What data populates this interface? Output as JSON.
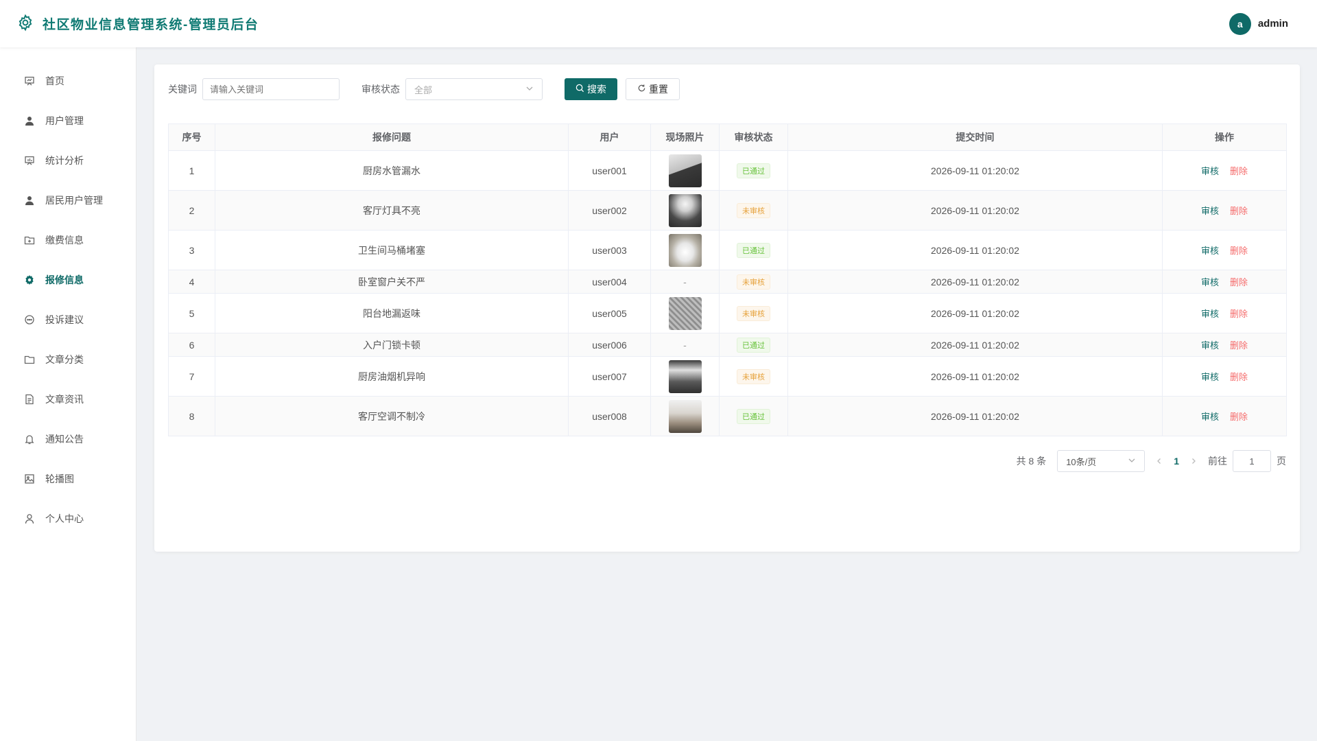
{
  "header": {
    "title": "社区物业信息管理系统-管理员后台",
    "avatar_letter": "a",
    "username": "admin"
  },
  "sidebar": {
    "items": [
      {
        "label": "首页",
        "icon": "dashboard-icon",
        "active": false
      },
      {
        "label": "用户管理",
        "icon": "user-icon",
        "active": false
      },
      {
        "label": "统计分析",
        "icon": "chart-icon",
        "active": false
      },
      {
        "label": "居民用户管理",
        "icon": "user-icon",
        "active": false
      },
      {
        "label": "缴费信息",
        "icon": "folder-add-icon",
        "active": false
      },
      {
        "label": "报修信息",
        "icon": "gear-icon",
        "active": true
      },
      {
        "label": "投诉建议",
        "icon": "chat-icon",
        "active": false
      },
      {
        "label": "文章分类",
        "icon": "folder-icon",
        "active": false
      },
      {
        "label": "文章资讯",
        "icon": "document-icon",
        "active": false
      },
      {
        "label": "通知公告",
        "icon": "bell-icon",
        "active": false
      },
      {
        "label": "轮播图",
        "icon": "picture-icon",
        "active": false
      },
      {
        "label": "个人中心",
        "icon": "person-icon",
        "active": false
      }
    ]
  },
  "filters": {
    "keyword_label": "关键词",
    "keyword_placeholder": "请输入关键词",
    "status_label": "审核状态",
    "status_value": "全部",
    "search_label": "搜索",
    "reset_label": "重置"
  },
  "table": {
    "columns": [
      "序号",
      "报修问题",
      "用户",
      "现场照片",
      "审核状态",
      "提交时间",
      "操作"
    ],
    "rows": [
      {
        "no": "1",
        "issue": "厨房水管漏水",
        "user": "user001",
        "photo": "kitchen-pipe",
        "status": "已通过",
        "time": "2026-09-11 01:20:02"
      },
      {
        "no": "2",
        "issue": "客厅灯具不亮",
        "user": "user002",
        "photo": "living-room-light",
        "status": "未审核",
        "time": "2026-09-11 01:20:02"
      },
      {
        "no": "3",
        "issue": "卫生间马桶堵塞",
        "user": "user003",
        "photo": "toilet",
        "status": "已通过",
        "time": "2026-09-11 01:20:02"
      },
      {
        "no": "4",
        "issue": "卧室窗户关不严",
        "user": "user004",
        "photo": "",
        "status": "未审核",
        "time": "2026-09-11 01:20:02"
      },
      {
        "no": "5",
        "issue": "阳台地漏返味",
        "user": "user005",
        "photo": "floor-drain",
        "status": "未审核",
        "time": "2026-09-11 01:20:02"
      },
      {
        "no": "6",
        "issue": "入户门锁卡顿",
        "user": "user006",
        "photo": "",
        "status": "已通过",
        "time": "2026-09-11 01:20:02"
      },
      {
        "no": "7",
        "issue": "厨房油烟机异响",
        "user": "user007",
        "photo": "range-hood",
        "status": "未审核",
        "time": "2026-09-11 01:20:02"
      },
      {
        "no": "8",
        "issue": "客厅空调不制冷",
        "user": "user008",
        "photo": "living-room-ac",
        "status": "已通过",
        "time": "2026-09-11 01:20:02"
      }
    ],
    "empty_photo": "-",
    "audit_label": "审核",
    "delete_label": "删除"
  },
  "pagination": {
    "total_text": "共 8 条",
    "page_size": "10条/页",
    "current_page": "1",
    "goto_label": "前往",
    "goto_value": "1",
    "page_suffix": "页"
  },
  "colors": {
    "primary": "#0f6a67",
    "pass": "#67c23a",
    "pending": "#e6a23c",
    "danger": "#f56c6c"
  }
}
